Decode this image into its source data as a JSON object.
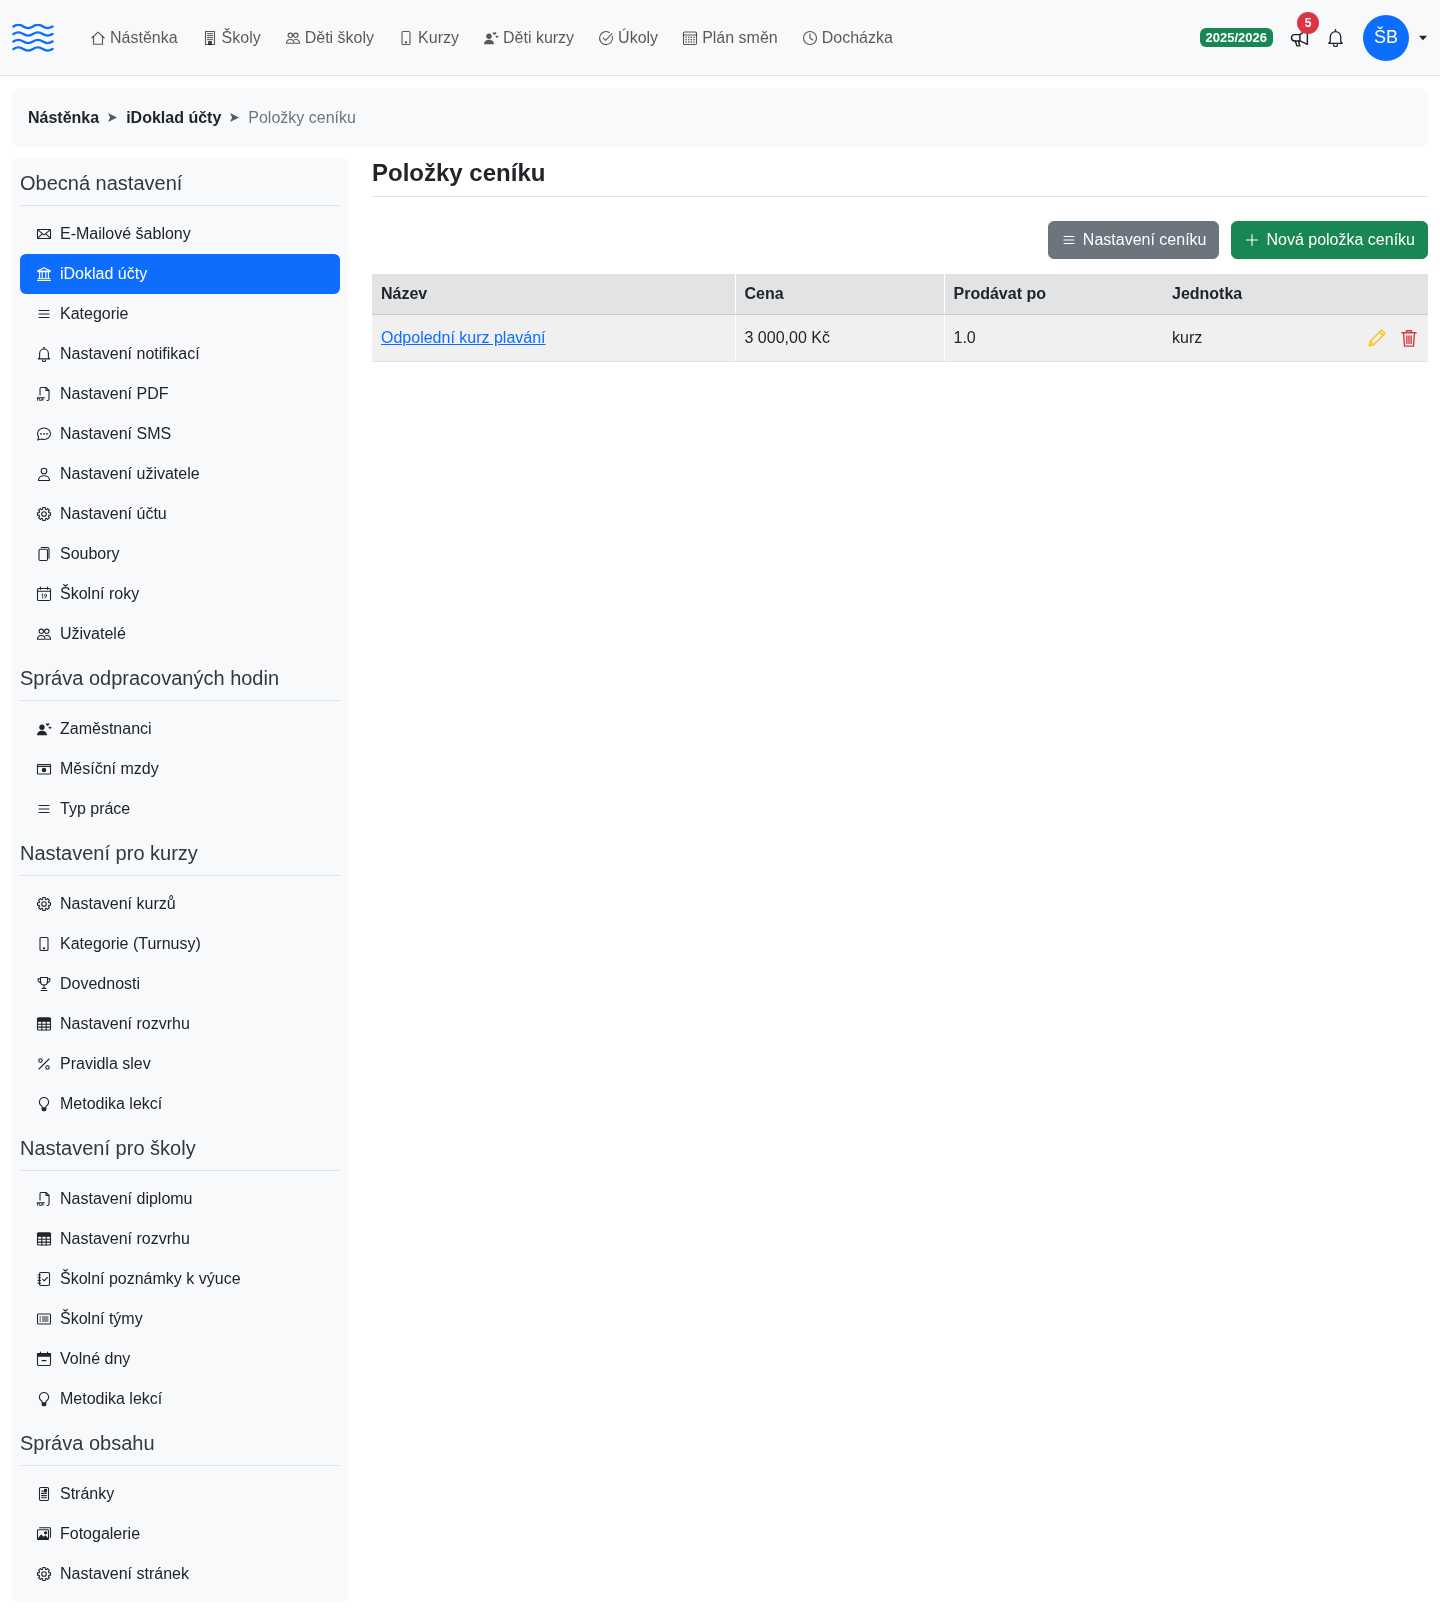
{
  "navbar": {
    "links": [
      {
        "label": "Nástěnka",
        "selected": false
      },
      {
        "label": "Školy",
        "selected": false
      },
      {
        "label": "Děti školy",
        "selected": false
      },
      {
        "label": "Kurzy",
        "selected": false
      },
      {
        "label": "Děti kurzy",
        "selected": false
      },
      {
        "label": "Úkoly",
        "selected": false
      },
      {
        "label": "Plán směn",
        "selected": false
      },
      {
        "label": "Docházka",
        "selected": false
      }
    ],
    "season_badge": "2025/2026",
    "announcements_count": "5",
    "avatar_initials": "ŠB"
  },
  "breadcrumb": [
    {
      "label": "Nástěnka",
      "current": false
    },
    {
      "label": "iDoklad účty",
      "current": false
    },
    {
      "label": "Položky ceníku",
      "current": true
    }
  ],
  "sidebar": {
    "groups": [
      {
        "title": "Obecná nastavení",
        "items": [
          {
            "label": "E-Mailové šablony",
            "selected": false
          },
          {
            "label": "iDoklad účty",
            "selected": true
          },
          {
            "label": "Kategorie",
            "selected": false
          },
          {
            "label": "Nastavení notifikací",
            "selected": false
          },
          {
            "label": "Nastavení PDF",
            "selected": false
          },
          {
            "label": "Nastavení SMS",
            "selected": false
          },
          {
            "label": "Nastavení uživatele",
            "selected": false
          },
          {
            "label": "Nastavení účtu",
            "selected": false
          },
          {
            "label": "Soubory",
            "selected": false
          },
          {
            "label": "Školní roky",
            "selected": false
          },
          {
            "label": "Uživatelé",
            "selected": false
          }
        ]
      },
      {
        "title": "Správa odpracovaných hodin",
        "items": [
          {
            "label": "Zaměstnanci",
            "selected": false
          },
          {
            "label": "Měsíční mzdy",
            "selected": false
          },
          {
            "label": "Typ práce",
            "selected": false
          }
        ]
      },
      {
        "title": "Nastavení pro kurzy",
        "items": [
          {
            "label": "Nastavení kurzů",
            "selected": false
          },
          {
            "label": "Kategorie (Turnusy)",
            "selected": false
          },
          {
            "label": "Dovednosti",
            "selected": false
          },
          {
            "label": "Nastavení rozvrhu",
            "selected": false
          },
          {
            "label": "Pravidla slev",
            "selected": false
          },
          {
            "label": "Metodika lekcí",
            "selected": false
          }
        ]
      },
      {
        "title": "Nastavení pro školy",
        "items": [
          {
            "label": "Nastavení diplomu",
            "selected": false
          },
          {
            "label": "Nastavení rozvrhu",
            "selected": false
          },
          {
            "label": "Školní poznámky k výuce",
            "selected": false
          },
          {
            "label": "Školní týmy",
            "selected": false
          },
          {
            "label": "Volné dny",
            "selected": false
          },
          {
            "label": "Metodika lekcí",
            "selected": false
          }
        ]
      },
      {
        "title": "Správa obsahu",
        "items": [
          {
            "label": "Stránky",
            "selected": false
          },
          {
            "label": "Fotogalerie",
            "selected": false
          },
          {
            "label": "Nastavení stránek",
            "selected": false
          }
        ]
      }
    ]
  },
  "main": {
    "title": "Položky ceníku",
    "buttons": [
      {
        "label": "Nastavení ceníku",
        "kind": "secondary"
      },
      {
        "label": "Nová položka ceníku",
        "kind": "success"
      }
    ],
    "table": {
      "columns": [
        "Název",
        "Cena",
        "Prodávat po",
        "Jednotka"
      ],
      "rows": [
        {
          "cells": [
            "Odpolední kurz plavání",
            "3 000,00 Kč",
            "1.0",
            "kurz"
          ]
        }
      ]
    }
  }
}
